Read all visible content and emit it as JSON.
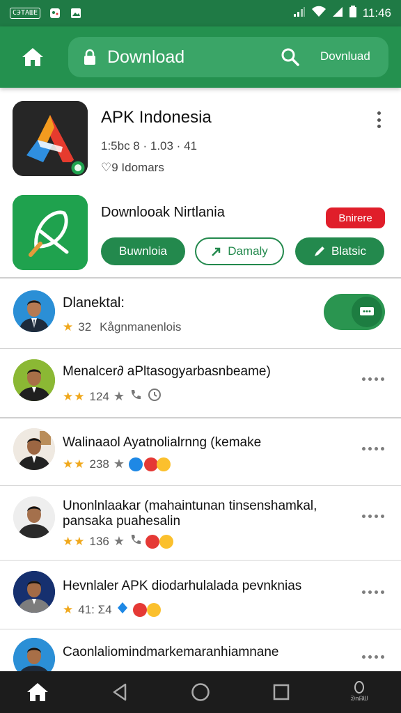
{
  "status_bar": {
    "chip_text": "СЭТАШЕ",
    "time": "11:46"
  },
  "app_bar": {
    "title": "Download",
    "right_text": "Dovnluad"
  },
  "app_cards": [
    {
      "title": "APK Indonesia",
      "meta_line_1": "1:5bc  8 · 1.03 · 41",
      "meta_line_2": "♡9  Idomars"
    },
    {
      "title": "Downlooak Nirtlania",
      "badge": "Bnirere",
      "buttons": [
        "Buwnloia",
        "Damaly",
        "Blatsic"
      ]
    }
  ],
  "list": [
    {
      "title": "Dlanektal:",
      "rating": "★",
      "count": "32",
      "meta": "Kågnmanenlois",
      "trailing": "toggle"
    },
    {
      "title": "Menalcer∂ aPltasogyarbasnbeame)",
      "rating": "★★",
      "count": "124",
      "trailing": "more"
    },
    {
      "title": "Walinaaol Ayatnolialrnng (kemake",
      "rating": "★★",
      "count": "238",
      "trailing": "more"
    },
    {
      "title": "Unonlnlaakar (mahaintunan tinsenshamkal,",
      "subtitle": "pansaka puahesalin",
      "rating": "★★",
      "count": "136",
      "trailing": "more"
    },
    {
      "title": "Hevnlaler APK diodarhulalada pevnknias",
      "rating": "★",
      "count": "41:  Σ4",
      "trailing": "more"
    },
    {
      "title": "Caonlaliomindmarkemaranhiamnane",
      "trailing": "more"
    }
  ],
  "nav_bar": {
    "label": "ᕲnᕱᗯ"
  },
  "colors": {
    "status_bar": "#1f7a45",
    "app_bar": "#24914f",
    "accent": "#23894d",
    "badge_red": "#e01e2a",
    "star": "#f0a81c",
    "nav_bar": "#1c1c1c"
  },
  "icons": [
    "home-icon",
    "lock-icon",
    "search-icon",
    "kebab-icon",
    "more-icon",
    "back-icon",
    "circle-home-icon",
    "recents-icon",
    "star-icon"
  ]
}
